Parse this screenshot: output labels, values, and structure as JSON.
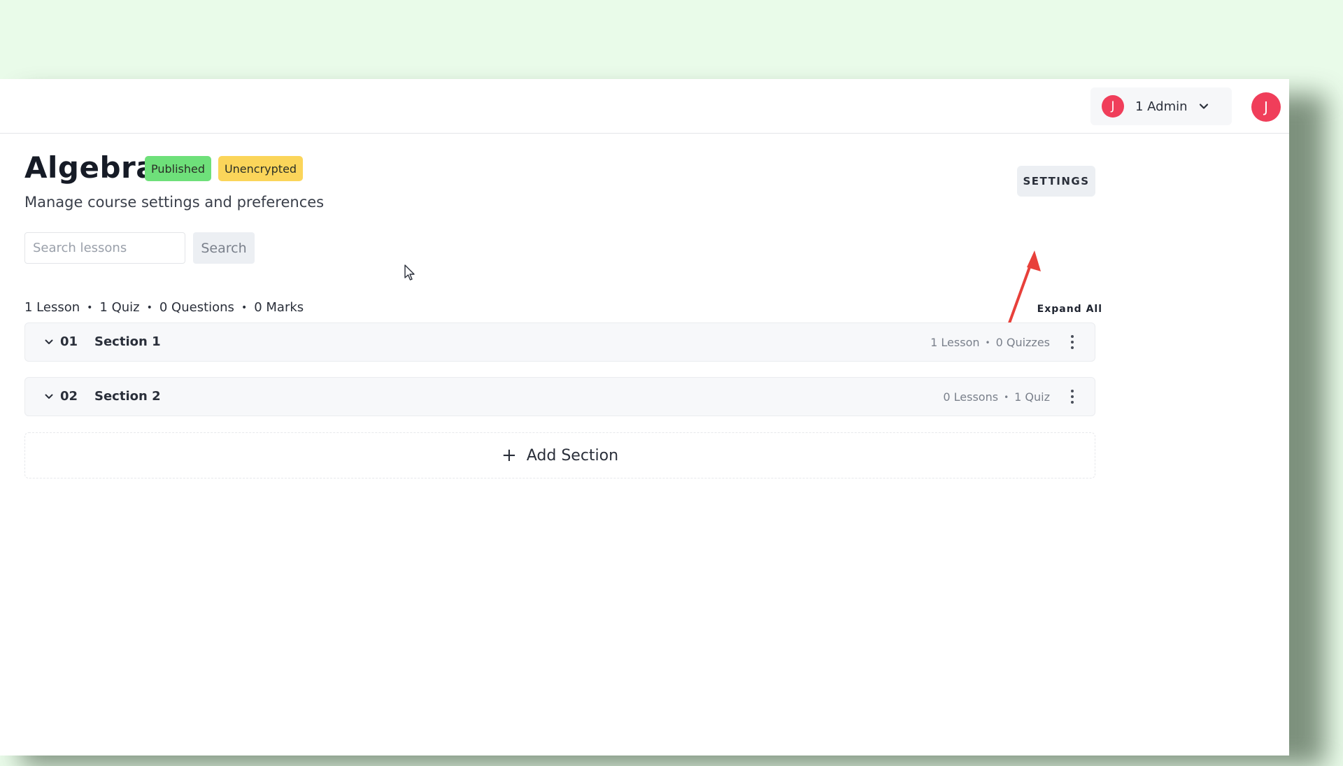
{
  "header": {
    "account": {
      "avatar_initial": "J",
      "name": "1 Admin"
    },
    "user_avatar_initial": "J"
  },
  "course": {
    "title": "Algebra",
    "status_badge": "Published",
    "encryption_badge": "Unencrypted",
    "subtitle": "Manage course settings and preferences",
    "settings_label": "SETTINGS"
  },
  "search": {
    "placeholder": "Search lessons",
    "value": "",
    "button_label": "Search"
  },
  "summary": {
    "lessons": "1 Lesson",
    "quizzes": "1 Quiz",
    "questions": "0 Questions",
    "marks": "0 Marks",
    "separator": "•"
  },
  "expand_all_label": "Expand All",
  "sections": [
    {
      "number": "01",
      "title": "Section 1",
      "lessons": "1 Lesson",
      "quizzes": "0 Quizzes"
    },
    {
      "number": "02",
      "title": "Section 2",
      "lessons": "0 Lessons",
      "quizzes": "1 Quiz"
    }
  ],
  "add_section_label": "Add Section",
  "colors": {
    "background": "#e9fbe9",
    "avatar": "#f03e5a",
    "published": "#6ee07a",
    "unencrypted": "#fbd55a",
    "annotation_arrow": "#e8403a"
  },
  "icons": {
    "account_chevron": "chevron-down-icon",
    "section_chevron": "chevron-down-icon",
    "section_menu": "kebab-menu-icon",
    "add": "plus-icon",
    "pointer": "mouse-cursor-icon",
    "annotation": "red-arrow-icon"
  }
}
